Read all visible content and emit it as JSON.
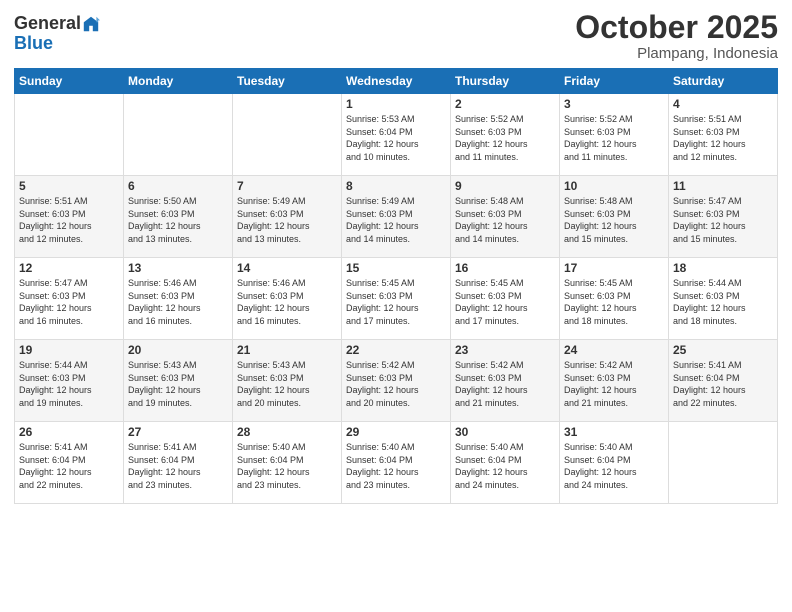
{
  "logo": {
    "general": "General",
    "blue": "Blue"
  },
  "header": {
    "month": "October 2025",
    "location": "Plampang, Indonesia"
  },
  "weekdays": [
    "Sunday",
    "Monday",
    "Tuesday",
    "Wednesday",
    "Thursday",
    "Friday",
    "Saturday"
  ],
  "weeks": [
    [
      {
        "day": "",
        "info": ""
      },
      {
        "day": "",
        "info": ""
      },
      {
        "day": "",
        "info": ""
      },
      {
        "day": "1",
        "info": "Sunrise: 5:53 AM\nSunset: 6:04 PM\nDaylight: 12 hours\nand 10 minutes."
      },
      {
        "day": "2",
        "info": "Sunrise: 5:52 AM\nSunset: 6:03 PM\nDaylight: 12 hours\nand 11 minutes."
      },
      {
        "day": "3",
        "info": "Sunrise: 5:52 AM\nSunset: 6:03 PM\nDaylight: 12 hours\nand 11 minutes."
      },
      {
        "day": "4",
        "info": "Sunrise: 5:51 AM\nSunset: 6:03 PM\nDaylight: 12 hours\nand 12 minutes."
      }
    ],
    [
      {
        "day": "5",
        "info": "Sunrise: 5:51 AM\nSunset: 6:03 PM\nDaylight: 12 hours\nand 12 minutes."
      },
      {
        "day": "6",
        "info": "Sunrise: 5:50 AM\nSunset: 6:03 PM\nDaylight: 12 hours\nand 13 minutes."
      },
      {
        "day": "7",
        "info": "Sunrise: 5:49 AM\nSunset: 6:03 PM\nDaylight: 12 hours\nand 13 minutes."
      },
      {
        "day": "8",
        "info": "Sunrise: 5:49 AM\nSunset: 6:03 PM\nDaylight: 12 hours\nand 14 minutes."
      },
      {
        "day": "9",
        "info": "Sunrise: 5:48 AM\nSunset: 6:03 PM\nDaylight: 12 hours\nand 14 minutes."
      },
      {
        "day": "10",
        "info": "Sunrise: 5:48 AM\nSunset: 6:03 PM\nDaylight: 12 hours\nand 15 minutes."
      },
      {
        "day": "11",
        "info": "Sunrise: 5:47 AM\nSunset: 6:03 PM\nDaylight: 12 hours\nand 15 minutes."
      }
    ],
    [
      {
        "day": "12",
        "info": "Sunrise: 5:47 AM\nSunset: 6:03 PM\nDaylight: 12 hours\nand 16 minutes."
      },
      {
        "day": "13",
        "info": "Sunrise: 5:46 AM\nSunset: 6:03 PM\nDaylight: 12 hours\nand 16 minutes."
      },
      {
        "day": "14",
        "info": "Sunrise: 5:46 AM\nSunset: 6:03 PM\nDaylight: 12 hours\nand 16 minutes."
      },
      {
        "day": "15",
        "info": "Sunrise: 5:45 AM\nSunset: 6:03 PM\nDaylight: 12 hours\nand 17 minutes."
      },
      {
        "day": "16",
        "info": "Sunrise: 5:45 AM\nSunset: 6:03 PM\nDaylight: 12 hours\nand 17 minutes."
      },
      {
        "day": "17",
        "info": "Sunrise: 5:45 AM\nSunset: 6:03 PM\nDaylight: 12 hours\nand 18 minutes."
      },
      {
        "day": "18",
        "info": "Sunrise: 5:44 AM\nSunset: 6:03 PM\nDaylight: 12 hours\nand 18 minutes."
      }
    ],
    [
      {
        "day": "19",
        "info": "Sunrise: 5:44 AM\nSunset: 6:03 PM\nDaylight: 12 hours\nand 19 minutes."
      },
      {
        "day": "20",
        "info": "Sunrise: 5:43 AM\nSunset: 6:03 PM\nDaylight: 12 hours\nand 19 minutes."
      },
      {
        "day": "21",
        "info": "Sunrise: 5:43 AM\nSunset: 6:03 PM\nDaylight: 12 hours\nand 20 minutes."
      },
      {
        "day": "22",
        "info": "Sunrise: 5:42 AM\nSunset: 6:03 PM\nDaylight: 12 hours\nand 20 minutes."
      },
      {
        "day": "23",
        "info": "Sunrise: 5:42 AM\nSunset: 6:03 PM\nDaylight: 12 hours\nand 21 minutes."
      },
      {
        "day": "24",
        "info": "Sunrise: 5:42 AM\nSunset: 6:03 PM\nDaylight: 12 hours\nand 21 minutes."
      },
      {
        "day": "25",
        "info": "Sunrise: 5:41 AM\nSunset: 6:04 PM\nDaylight: 12 hours\nand 22 minutes."
      }
    ],
    [
      {
        "day": "26",
        "info": "Sunrise: 5:41 AM\nSunset: 6:04 PM\nDaylight: 12 hours\nand 22 minutes."
      },
      {
        "day": "27",
        "info": "Sunrise: 5:41 AM\nSunset: 6:04 PM\nDaylight: 12 hours\nand 23 minutes."
      },
      {
        "day": "28",
        "info": "Sunrise: 5:40 AM\nSunset: 6:04 PM\nDaylight: 12 hours\nand 23 minutes."
      },
      {
        "day": "29",
        "info": "Sunrise: 5:40 AM\nSunset: 6:04 PM\nDaylight: 12 hours\nand 23 minutes."
      },
      {
        "day": "30",
        "info": "Sunrise: 5:40 AM\nSunset: 6:04 PM\nDaylight: 12 hours\nand 24 minutes."
      },
      {
        "day": "31",
        "info": "Sunrise: 5:40 AM\nSunset: 6:04 PM\nDaylight: 12 hours\nand 24 minutes."
      },
      {
        "day": "",
        "info": ""
      }
    ]
  ]
}
